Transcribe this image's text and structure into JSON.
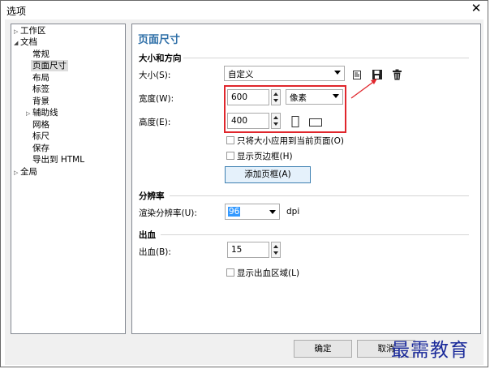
{
  "window": {
    "title": "选项",
    "close_icon": "close-icon"
  },
  "tree": {
    "items": [
      {
        "label": "工作区",
        "arrow": "▷"
      },
      {
        "label": "文档",
        "arrow": "◢"
      },
      {
        "label": "常规",
        "arrow": ""
      },
      {
        "label": "页面尺寸",
        "arrow": "",
        "selected": true
      },
      {
        "label": "布局",
        "arrow": ""
      },
      {
        "label": "标签",
        "arrow": ""
      },
      {
        "label": "背景",
        "arrow": ""
      },
      {
        "label": "辅助线",
        "arrow": "▷"
      },
      {
        "label": "网格",
        "arrow": ""
      },
      {
        "label": "标尺",
        "arrow": ""
      },
      {
        "label": "保存",
        "arrow": ""
      },
      {
        "label": "导出到 HTML",
        "arrow": ""
      },
      {
        "label": "全局",
        "arrow": "▷"
      }
    ]
  },
  "panel": {
    "title": "页面尺寸",
    "size_section": {
      "title": "大小和方向",
      "size_label": "大小(S):",
      "size_value": "自定义",
      "width_label": "宽度(W):",
      "width_value": "600",
      "unit_value": "像素",
      "height_label": "高度(E):",
      "height_value": "400",
      "apply_current_label": "只将大小应用到当前页面(O)",
      "show_border_label": "显示页边框(H)",
      "add_frame_button": "添加页框(A)"
    },
    "resolution_section": {
      "title": "分辨率",
      "render_label": "渲染分辨率(U):",
      "render_value": "96",
      "unit": "dpi"
    },
    "bleed_section": {
      "title": "出血",
      "bleed_label": "出血(B):",
      "bleed_value": "15",
      "show_bleed_label": "显示出血区域(L)"
    }
  },
  "footer": {
    "ok_button": "确定",
    "cancel_button": "取消"
  },
  "watermark": "最需教育",
  "colors": {
    "accent_blue": "#2e6fa8",
    "highlight_red": "#e0262c",
    "watermark_blue": "#1a2a9a"
  }
}
